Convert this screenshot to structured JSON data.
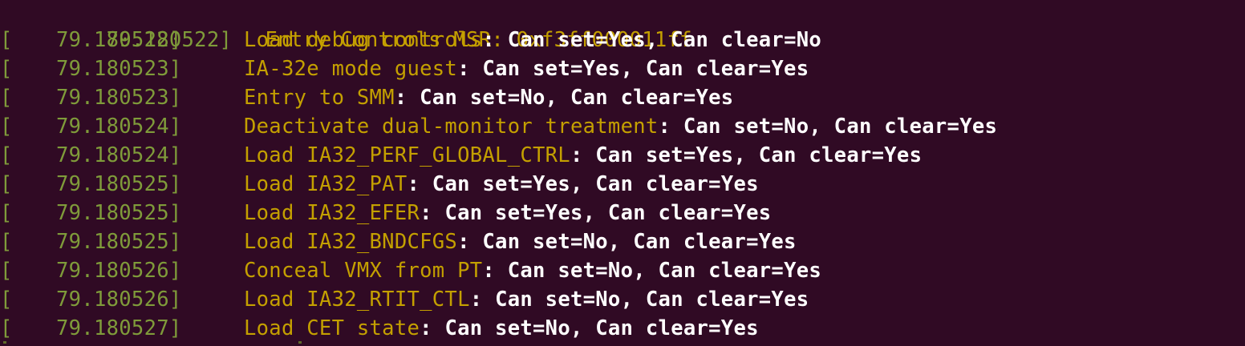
{
  "colors": {
    "background": "#300a24",
    "timestamp": "#7f9b3a",
    "field_name": "#c4a000",
    "field_value": "#ffffff"
  },
  "header": {
    "timestamp": "79.180522",
    "label": "Entry Controls MSR",
    "value": "0xf3ff000011ff"
  },
  "lines": [
    {
      "timestamp": "79.180522",
      "name": "Load debug controls",
      "value": "Can set=Yes, Can clear=No"
    },
    {
      "timestamp": "79.180523",
      "name": "IA-32e mode guest",
      "value": "Can set=Yes, Can clear=Yes"
    },
    {
      "timestamp": "79.180523",
      "name": "Entry to SMM",
      "value": "Can set=No, Can clear=Yes"
    },
    {
      "timestamp": "79.180524",
      "name": "Deactivate dual-monitor treatment",
      "value": "Can set=No, Can clear=Yes"
    },
    {
      "timestamp": "79.180524",
      "name": "Load IA32_PERF_GLOBAL_CTRL",
      "value": "Can set=Yes, Can clear=Yes"
    },
    {
      "timestamp": "79.180525",
      "name": "Load IA32_PAT",
      "value": "Can set=Yes, Can clear=Yes"
    },
    {
      "timestamp": "79.180525",
      "name": "Load IA32_EFER",
      "value": "Can set=Yes, Can clear=Yes"
    },
    {
      "timestamp": "79.180525",
      "name": "Load IA32_BNDCFGS",
      "value": "Can set=No, Can clear=Yes"
    },
    {
      "timestamp": "79.180526",
      "name": "Conceal VMX from PT",
      "value": "Can set=No, Can clear=Yes"
    },
    {
      "timestamp": "79.180526",
      "name": "Load IA32_RTIT_CTL",
      "value": "Can set=No, Can clear=Yes"
    },
    {
      "timestamp": "79.180527",
      "name": "Load CET state",
      "value": "Can set=No, Can clear=Yes"
    }
  ]
}
